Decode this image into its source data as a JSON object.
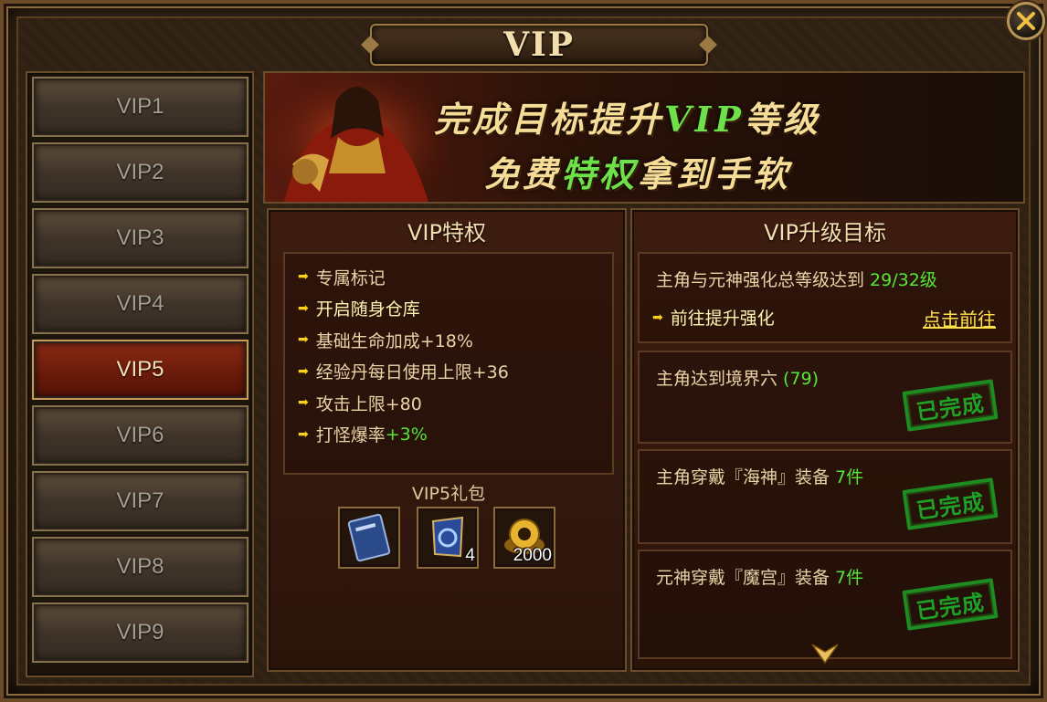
{
  "window": {
    "title": "VIP"
  },
  "sidebar": {
    "tabs": [
      {
        "label": "VIP1",
        "active": false
      },
      {
        "label": "VIP2",
        "active": false
      },
      {
        "label": "VIP3",
        "active": false
      },
      {
        "label": "VIP4",
        "active": false
      },
      {
        "label": "VIP5",
        "active": true
      },
      {
        "label": "VIP6",
        "active": false
      },
      {
        "label": "VIP7",
        "active": false
      },
      {
        "label": "VIP8",
        "active": false
      },
      {
        "label": "VIP9",
        "active": false
      }
    ]
  },
  "banner": {
    "line1_a": "完成目标提升",
    "line1_hl": "VIP",
    "line1_b": "等级",
    "line2_a": "免费",
    "line2_hl": "特权",
    "line2_b": "拿到手软"
  },
  "privileges": {
    "title": "VIP特权",
    "items": [
      {
        "text": "专属标记",
        "extra": ""
      },
      {
        "text": "开启随身仓库",
        "extra": ""
      },
      {
        "text": "基础生命加成+18%",
        "extra": ""
      },
      {
        "text": "经验丹每日使用上限+36",
        "extra": ""
      },
      {
        "text": "攻击上限+80",
        "extra": ""
      },
      {
        "text": "打怪爆率",
        "extra": "+3%"
      }
    ],
    "gift_title": "VIP5礼包",
    "gifts": [
      {
        "icon": "blue-book-icon",
        "count": ""
      },
      {
        "icon": "blue-rune-stone-icon",
        "count": "4"
      },
      {
        "icon": "gold-coin-pile-icon",
        "count": "2000"
      }
    ]
  },
  "goals": {
    "title": "VIP升级目标",
    "items": [
      {
        "text": "主角与元神强化总等级达到 ",
        "progress": "29/32级",
        "sub": "前往提升强化",
        "link": "点击前往",
        "done": false
      },
      {
        "text": "主角达到境界六 ",
        "progress": "(79)",
        "done": true,
        "stamp": "已完成"
      },
      {
        "text": "主角穿戴『海神』装备 ",
        "progress": "7件",
        "done": true,
        "stamp": "已完成"
      },
      {
        "text": "元神穿戴『魔宫』装备 ",
        "progress": "7件",
        "done": true,
        "stamp": "已完成"
      }
    ]
  },
  "colors": {
    "accent_green": "#56e63a",
    "active_tab": "#6a1a0a",
    "link": "#ffe04a"
  }
}
